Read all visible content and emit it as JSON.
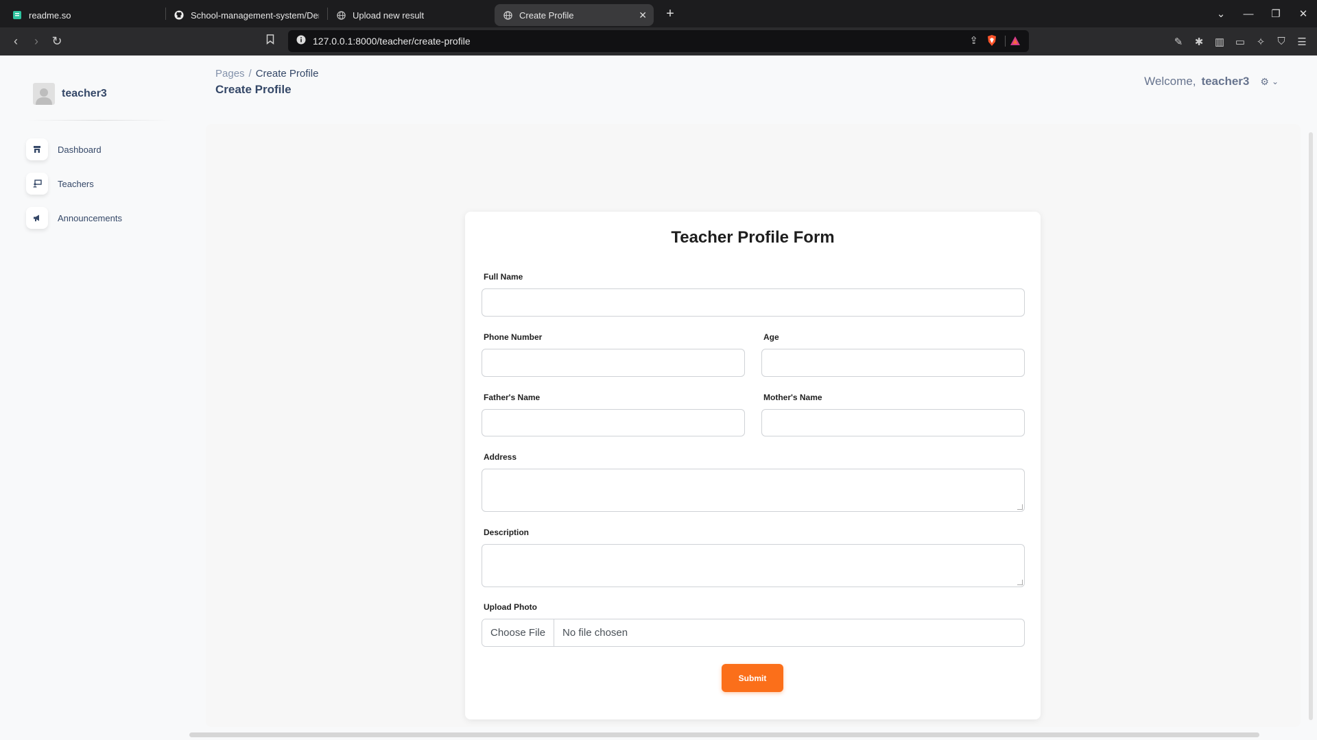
{
  "browser": {
    "tabs": [
      {
        "title": "readme.so",
        "icon": "readme-icon",
        "active": false
      },
      {
        "title": "School-management-system/Demo",
        "icon": "github-icon",
        "active": false
      },
      {
        "title": "Upload new result",
        "icon": "globe-icon",
        "active": false
      },
      {
        "title": "Create Profile",
        "icon": "globe-icon",
        "active": true
      }
    ],
    "new_tab": "+",
    "url": "127.0.0.1:8000/teacher/create-profile"
  },
  "sidebar": {
    "username": "teacher3",
    "items": [
      {
        "label": "Dashboard",
        "icon": "shop-icon"
      },
      {
        "label": "Teachers",
        "icon": "teachers-icon"
      },
      {
        "label": "Announcements",
        "icon": "megaphone-icon"
      }
    ]
  },
  "header": {
    "breadcrumb_root": "Pages",
    "breadcrumb_sep": "/",
    "breadcrumb_current": "Create Profile",
    "title": "Create Profile",
    "welcome": "Welcome,",
    "username": "teacher3"
  },
  "form": {
    "title": "Teacher Profile Form",
    "full_name": {
      "label": "Full Name",
      "value": ""
    },
    "phone": {
      "label": "Phone Number",
      "value": ""
    },
    "age": {
      "label": "Age",
      "value": ""
    },
    "father": {
      "label": "Father's Name",
      "value": ""
    },
    "mother": {
      "label": "Mother's Name",
      "value": ""
    },
    "address": {
      "label": "Address",
      "value": ""
    },
    "description": {
      "label": "Description",
      "value": ""
    },
    "photo": {
      "label": "Upload Photo",
      "button": "Choose File",
      "status": "No file chosen"
    },
    "submit": "Submit"
  },
  "colors": {
    "accent": "#fb6f1a",
    "text": "#344767"
  }
}
